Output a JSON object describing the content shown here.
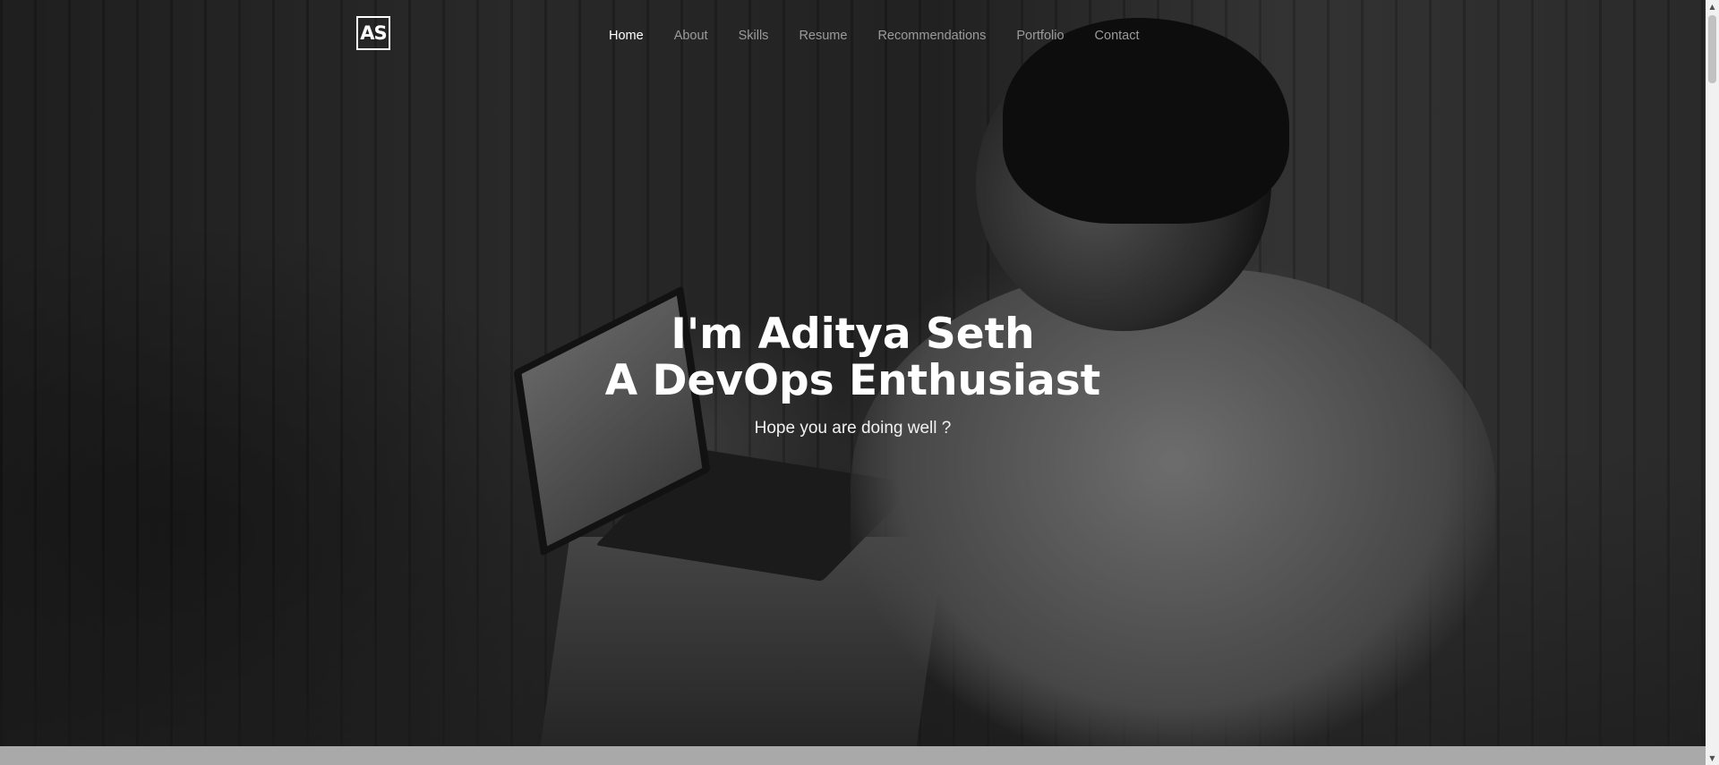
{
  "logo": {
    "text": "AS"
  },
  "nav": {
    "items": [
      {
        "label": "Home",
        "active": true
      },
      {
        "label": "About",
        "active": false
      },
      {
        "label": "Skills",
        "active": false
      },
      {
        "label": "Resume",
        "active": false
      },
      {
        "label": "Recommendations",
        "active": false
      },
      {
        "label": "Portfolio",
        "active": false
      },
      {
        "label": "Contact",
        "active": false
      }
    ]
  },
  "hero": {
    "line1": "I'm Aditya Seth",
    "line2": "A DevOps Enthusiast",
    "subtitle": "Hope you are doing well ?"
  },
  "colors": {
    "nav_active": "#ffffff",
    "nav_inactive": "#9b9b9b",
    "text": "#ffffff"
  }
}
